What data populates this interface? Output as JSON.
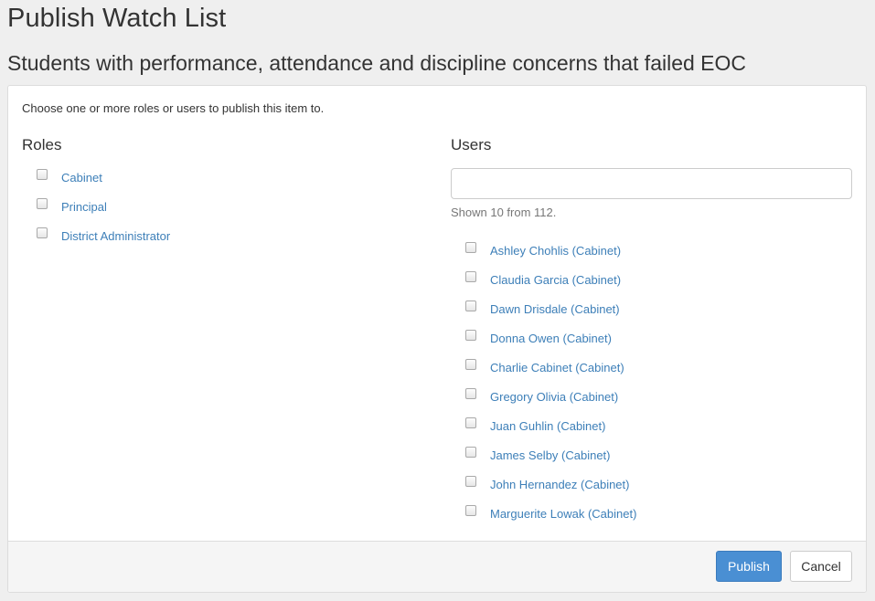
{
  "header": {
    "title": "Publish Watch List",
    "subtitle": "Students with performance, attendance and discipline concerns that failed EOC"
  },
  "form": {
    "instructions": "Choose one or more roles or users to publish this item to.",
    "roles": {
      "heading": "Roles",
      "items": [
        {
          "label": "Cabinet",
          "checked": false
        },
        {
          "label": "Principal",
          "checked": false
        },
        {
          "label": "District Administrator",
          "checked": false
        }
      ]
    },
    "users": {
      "heading": "Users",
      "search_value": "",
      "search_placeholder": "",
      "shown_text": "Shown 10 from 112.",
      "items": [
        {
          "label": "Ashley Chohlis (Cabinet)",
          "checked": false
        },
        {
          "label": "Claudia Garcia (Cabinet)",
          "checked": false
        },
        {
          "label": "Dawn Drisdale (Cabinet)",
          "checked": false
        },
        {
          "label": "Donna Owen (Cabinet)",
          "checked": false
        },
        {
          "label": "Charlie Cabinet (Cabinet)",
          "checked": false
        },
        {
          "label": "Gregory Olivia (Cabinet)",
          "checked": false
        },
        {
          "label": "Juan Guhlin (Cabinet)",
          "checked": false
        },
        {
          "label": "James Selby (Cabinet)",
          "checked": false
        },
        {
          "label": "John Hernandez (Cabinet)",
          "checked": false
        },
        {
          "label": "Marguerite Lowak (Cabinet)",
          "checked": false
        }
      ]
    }
  },
  "footer": {
    "publish_label": "Publish",
    "cancel_label": "Cancel"
  },
  "colors": {
    "link": "#3d7fb8",
    "primary_button": "#4a8fd3",
    "page_background": "#efefef"
  }
}
